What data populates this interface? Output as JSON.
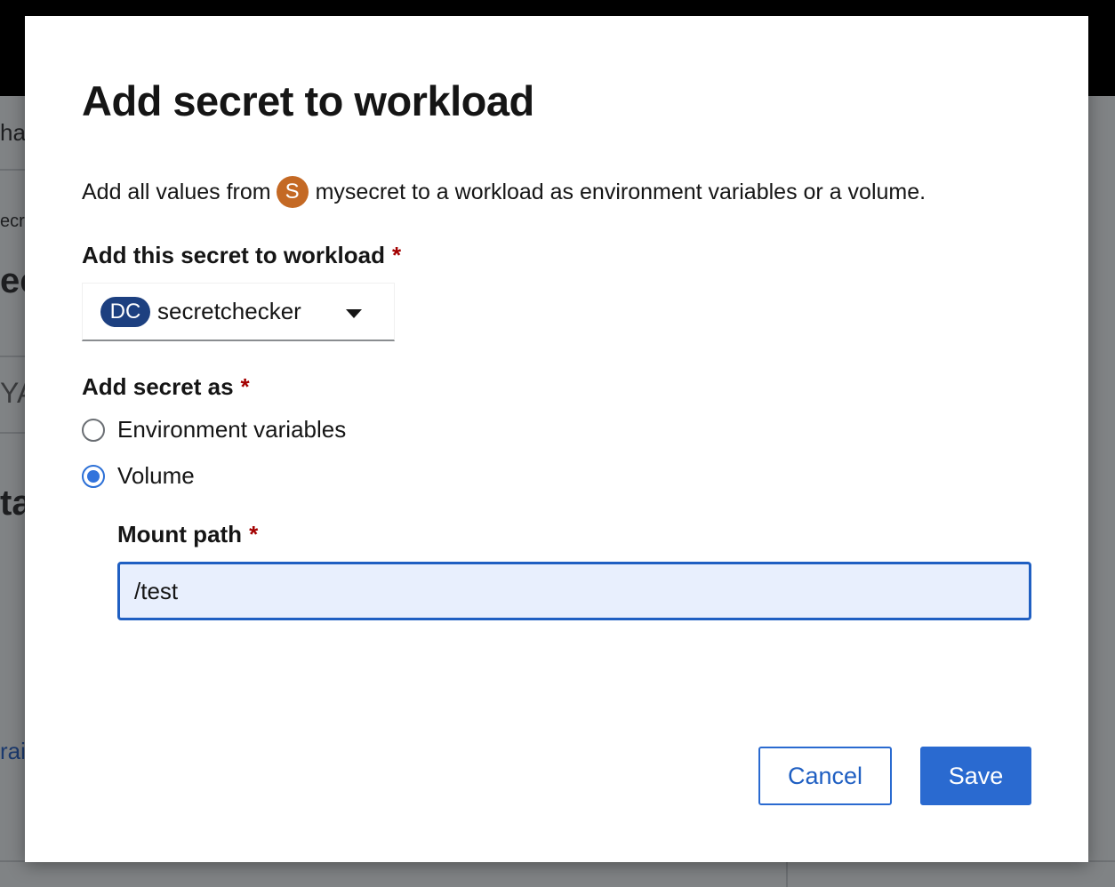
{
  "background": {
    "fragments": [
      "ha",
      "ecr",
      "ec",
      "YA",
      "ta",
      "rai"
    ]
  },
  "modal": {
    "title": "Add secret to workload",
    "description": {
      "prefix": "Add all values from",
      "secret_badge": "S",
      "secret_name": "mysecret",
      "suffix": "to a workload as environment variables or a volume."
    },
    "workload_field": {
      "label": "Add this secret to workload",
      "required_mark": "*",
      "selected_badge": "DC",
      "selected_value": "secretchecker"
    },
    "add_as_field": {
      "label": "Add secret as",
      "required_mark": "*",
      "options": [
        {
          "label": "Environment variables",
          "checked": false
        },
        {
          "label": "Volume",
          "checked": true
        }
      ]
    },
    "mount_path": {
      "label": "Mount path",
      "required_mark": "*",
      "value": "/test"
    },
    "buttons": {
      "cancel": "Cancel",
      "save": "Save"
    }
  },
  "colors": {
    "primary": "#2a6ad0",
    "secret_badge": "#c46924",
    "workload_badge": "#1d4080",
    "required": "#a30000"
  }
}
